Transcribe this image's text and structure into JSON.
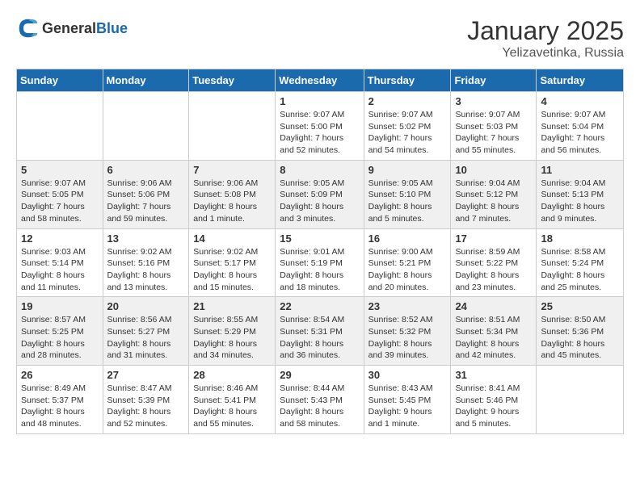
{
  "header": {
    "logo_general": "General",
    "logo_blue": "Blue",
    "title": "January 2025",
    "subtitle": "Yelizavetinka, Russia"
  },
  "weekdays": [
    "Sunday",
    "Monday",
    "Tuesday",
    "Wednesday",
    "Thursday",
    "Friday",
    "Saturday"
  ],
  "weeks": [
    [
      {
        "day": "",
        "info": ""
      },
      {
        "day": "",
        "info": ""
      },
      {
        "day": "",
        "info": ""
      },
      {
        "day": "1",
        "info": "Sunrise: 9:07 AM\nSunset: 5:00 PM\nDaylight: 7 hours\nand 52 minutes."
      },
      {
        "day": "2",
        "info": "Sunrise: 9:07 AM\nSunset: 5:02 PM\nDaylight: 7 hours\nand 54 minutes."
      },
      {
        "day": "3",
        "info": "Sunrise: 9:07 AM\nSunset: 5:03 PM\nDaylight: 7 hours\nand 55 minutes."
      },
      {
        "day": "4",
        "info": "Sunrise: 9:07 AM\nSunset: 5:04 PM\nDaylight: 7 hours\nand 56 minutes."
      }
    ],
    [
      {
        "day": "5",
        "info": "Sunrise: 9:07 AM\nSunset: 5:05 PM\nDaylight: 7 hours\nand 58 minutes."
      },
      {
        "day": "6",
        "info": "Sunrise: 9:06 AM\nSunset: 5:06 PM\nDaylight: 7 hours\nand 59 minutes."
      },
      {
        "day": "7",
        "info": "Sunrise: 9:06 AM\nSunset: 5:08 PM\nDaylight: 8 hours\nand 1 minute."
      },
      {
        "day": "8",
        "info": "Sunrise: 9:05 AM\nSunset: 5:09 PM\nDaylight: 8 hours\nand 3 minutes."
      },
      {
        "day": "9",
        "info": "Sunrise: 9:05 AM\nSunset: 5:10 PM\nDaylight: 8 hours\nand 5 minutes."
      },
      {
        "day": "10",
        "info": "Sunrise: 9:04 AM\nSunset: 5:12 PM\nDaylight: 8 hours\nand 7 minutes."
      },
      {
        "day": "11",
        "info": "Sunrise: 9:04 AM\nSunset: 5:13 PM\nDaylight: 8 hours\nand 9 minutes."
      }
    ],
    [
      {
        "day": "12",
        "info": "Sunrise: 9:03 AM\nSunset: 5:14 PM\nDaylight: 8 hours\nand 11 minutes."
      },
      {
        "day": "13",
        "info": "Sunrise: 9:02 AM\nSunset: 5:16 PM\nDaylight: 8 hours\nand 13 minutes."
      },
      {
        "day": "14",
        "info": "Sunrise: 9:02 AM\nSunset: 5:17 PM\nDaylight: 8 hours\nand 15 minutes."
      },
      {
        "day": "15",
        "info": "Sunrise: 9:01 AM\nSunset: 5:19 PM\nDaylight: 8 hours\nand 18 minutes."
      },
      {
        "day": "16",
        "info": "Sunrise: 9:00 AM\nSunset: 5:21 PM\nDaylight: 8 hours\nand 20 minutes."
      },
      {
        "day": "17",
        "info": "Sunrise: 8:59 AM\nSunset: 5:22 PM\nDaylight: 8 hours\nand 23 minutes."
      },
      {
        "day": "18",
        "info": "Sunrise: 8:58 AM\nSunset: 5:24 PM\nDaylight: 8 hours\nand 25 minutes."
      }
    ],
    [
      {
        "day": "19",
        "info": "Sunrise: 8:57 AM\nSunset: 5:25 PM\nDaylight: 8 hours\nand 28 minutes."
      },
      {
        "day": "20",
        "info": "Sunrise: 8:56 AM\nSunset: 5:27 PM\nDaylight: 8 hours\nand 31 minutes."
      },
      {
        "day": "21",
        "info": "Sunrise: 8:55 AM\nSunset: 5:29 PM\nDaylight: 8 hours\nand 34 minutes."
      },
      {
        "day": "22",
        "info": "Sunrise: 8:54 AM\nSunset: 5:31 PM\nDaylight: 8 hours\nand 36 minutes."
      },
      {
        "day": "23",
        "info": "Sunrise: 8:52 AM\nSunset: 5:32 PM\nDaylight: 8 hours\nand 39 minutes."
      },
      {
        "day": "24",
        "info": "Sunrise: 8:51 AM\nSunset: 5:34 PM\nDaylight: 8 hours\nand 42 minutes."
      },
      {
        "day": "25",
        "info": "Sunrise: 8:50 AM\nSunset: 5:36 PM\nDaylight: 8 hours\nand 45 minutes."
      }
    ],
    [
      {
        "day": "26",
        "info": "Sunrise: 8:49 AM\nSunset: 5:37 PM\nDaylight: 8 hours\nand 48 minutes."
      },
      {
        "day": "27",
        "info": "Sunrise: 8:47 AM\nSunset: 5:39 PM\nDaylight: 8 hours\nand 52 minutes."
      },
      {
        "day": "28",
        "info": "Sunrise: 8:46 AM\nSunset: 5:41 PM\nDaylight: 8 hours\nand 55 minutes."
      },
      {
        "day": "29",
        "info": "Sunrise: 8:44 AM\nSunset: 5:43 PM\nDaylight: 8 hours\nand 58 minutes."
      },
      {
        "day": "30",
        "info": "Sunrise: 8:43 AM\nSunset: 5:45 PM\nDaylight: 9 hours\nand 1 minute."
      },
      {
        "day": "31",
        "info": "Sunrise: 8:41 AM\nSunset: 5:46 PM\nDaylight: 9 hours\nand 5 minutes."
      },
      {
        "day": "",
        "info": ""
      }
    ]
  ]
}
